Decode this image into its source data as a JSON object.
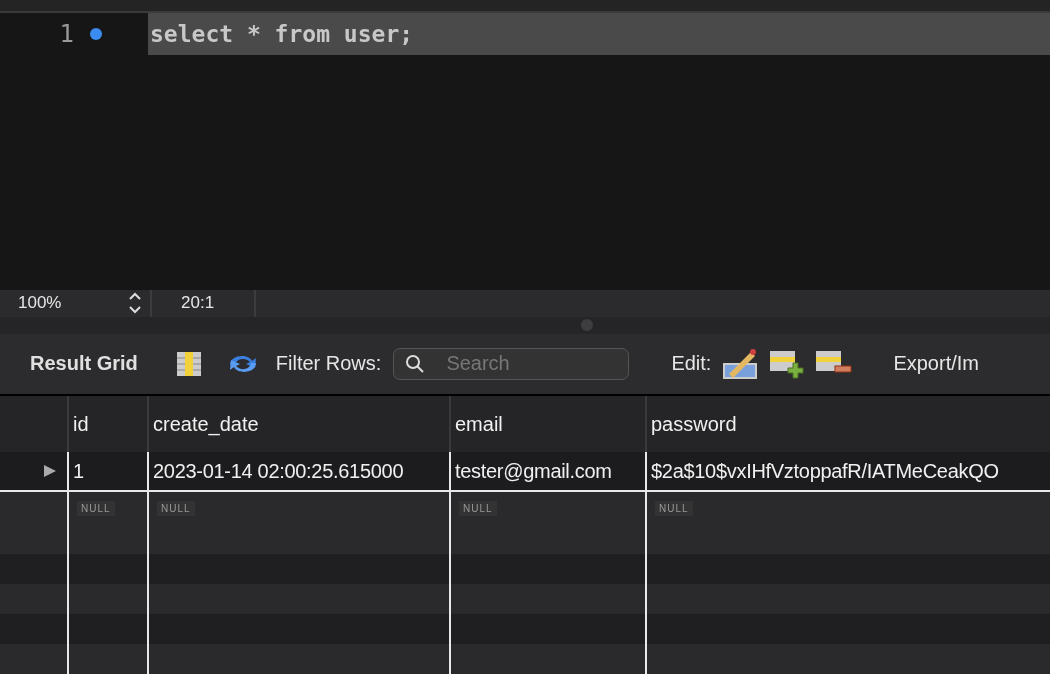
{
  "editor": {
    "lines": [
      {
        "number": "1",
        "code": "select * from user;",
        "current": true
      }
    ]
  },
  "status_bar": {
    "zoom": "100%",
    "position": "20:1"
  },
  "toolbar": {
    "title": "Result Grid",
    "filter_label": "Filter Rows:",
    "search": {
      "placeholder": "Search"
    },
    "edit_label": "Edit:",
    "export_label": "Export/Im"
  },
  "table": {
    "columns": [
      "id",
      "create_date",
      "email",
      "password"
    ],
    "rows": [
      {
        "kind": "data",
        "selected": true,
        "cells": [
          "1",
          "2023-01-14 02:00:25.615000",
          "tester@gmail.com",
          "$2a$10$vxIHfVztoppafR/IATMeCeakQO"
        ]
      },
      {
        "kind": "null",
        "selected": false,
        "cells": [
          "NULL",
          "NULL",
          "NULL",
          "NULL"
        ]
      }
    ]
  }
}
